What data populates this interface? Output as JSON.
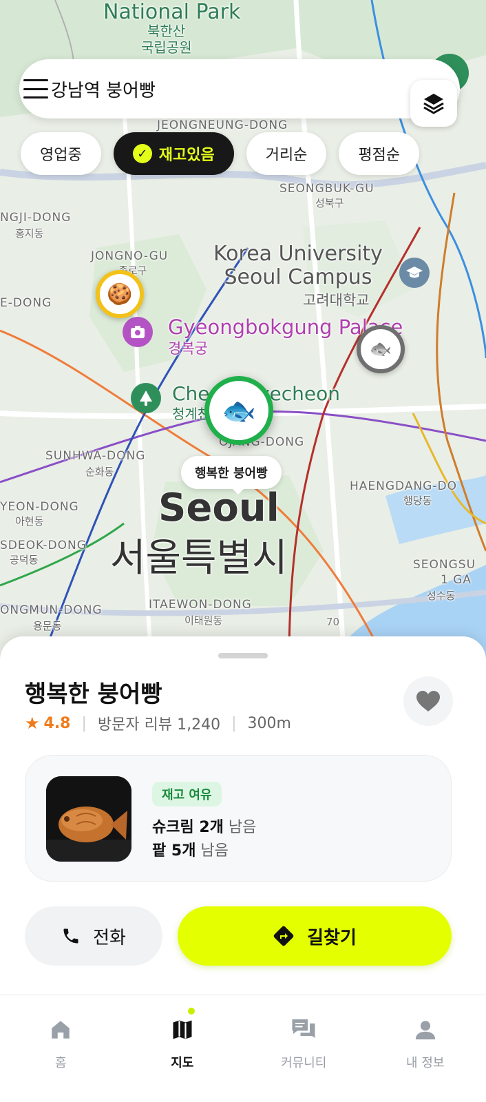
{
  "map": {
    "labels": {
      "national_park": "National Park",
      "national_park_ko_1": "북한산",
      "national_park_ko_2": "국립공원",
      "jeongneung": "JEONGNEUNG-DONG",
      "seongbuk": "SEONGBUK-GU",
      "seongbuk_ko": "성북구",
      "hongji": "NGJI-DONG",
      "hongji_ko": "홍지동",
      "jongno": "JONGNO-GU",
      "jongno_ko": "종로구",
      "korea_univ_1": "Korea University",
      "korea_univ_2": "Seoul Campus",
      "korea_univ_ko": "고려대학교",
      "e_dong": "E-DONG",
      "palace": "Gyeongbokgung Palace",
      "palace_ko": "경복궁",
      "stream": "Cheonggyecheon",
      "stream_ko": "청계천",
      "ojang": "OJANG-DONG",
      "sunhwa": "SUNHWA-DONG",
      "sunhwa_ko": "순화동",
      "aheyon": "YEON-DONG",
      "aheyon_ko": "아현동",
      "gongdeok": "SDEOK-DONG",
      "gongdeok_ko": "공덕동",
      "yongmun": "ONGMUN-DONG",
      "yongmun_ko": "용문동",
      "itaewon": "ITAEWON-DONG",
      "itaewon_ko": "이태원동",
      "haengdang": "HAENGDANG-DO",
      "haengdang_ko": "행당동",
      "seongsu": "SEONGSU",
      "seongsu_2": "1 GA",
      "seongsu_ko": "성수동",
      "seoul": "Seoul",
      "seoul_ko": "서울특별시",
      "route_70": "70"
    },
    "markers": {
      "main_tooltip": "행복한 붕어빵",
      "cookie_icon": "🍪",
      "fish_icon": "🐟"
    }
  },
  "search": {
    "query": "강남역 붕어빵"
  },
  "filters": {
    "chips": [
      {
        "label": "영업중",
        "active": false
      },
      {
        "label": "재고있음",
        "active": true
      },
      {
        "label": "거리순",
        "active": false
      },
      {
        "label": "평점순",
        "active": false
      }
    ]
  },
  "store": {
    "name": "행복한 붕어빵",
    "rating": "4.8",
    "reviews": "방문자 리뷰 1,240",
    "distance": "300m",
    "stock": {
      "badge": "재고 여유",
      "item1_name": "슈크림 2개",
      "item1_suffix": " 남음",
      "item2_name": "팥 5개",
      "item2_suffix": " 남음"
    },
    "call_label": "전화",
    "directions_label": "길찾기"
  },
  "nav": {
    "items": [
      {
        "label": "홈",
        "icon": "home-icon"
      },
      {
        "label": "지도",
        "icon": "map-icon",
        "active": true
      },
      {
        "label": "커뮤니티",
        "icon": "chat-icon"
      },
      {
        "label": "내 정보",
        "icon": "person-icon"
      }
    ]
  },
  "colors": {
    "accent": "#e4ff00",
    "in_stock_green": "#20b04b",
    "rating_orange": "#f07b1a"
  }
}
